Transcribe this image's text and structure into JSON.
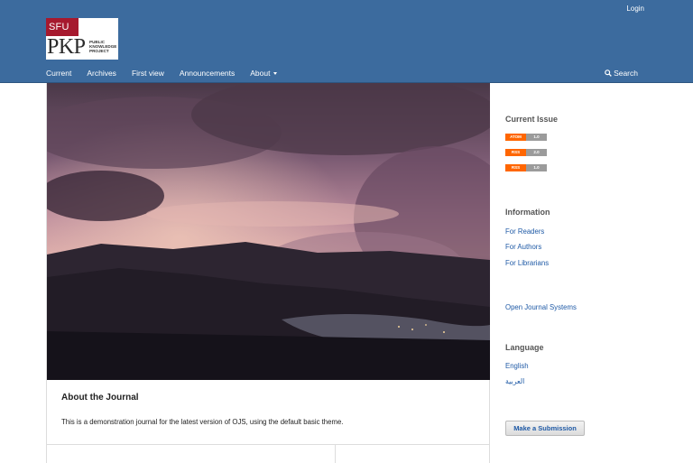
{
  "header": {
    "login_label": "Login",
    "logo": {
      "sfu": "SFU",
      "pkp": "PKP",
      "words": [
        "Public",
        "Knowledge",
        "Project"
      ]
    },
    "nav": [
      "Current",
      "Archives",
      "First view",
      "Announcements",
      "About"
    ],
    "search_label": "Search",
    "bg_color": "#3c6b9e"
  },
  "main": {
    "about_title": "About the Journal",
    "about_text": "This is a demonstration journal for the latest version of OJS, using the default basic theme."
  },
  "sidebar": {
    "current_issue_title": "Current Issue",
    "badges": [
      {
        "left": "ATOM",
        "right": "1.0"
      },
      {
        "left": "RSS",
        "right": "2.0"
      },
      {
        "left": "RSS",
        "right": "1.0"
      }
    ],
    "information_title": "Information",
    "info_links": [
      "For Readers",
      "For Authors",
      "For Librarians"
    ],
    "ojs_link": "Open Journal Systems",
    "language_title": "Language",
    "languages": [
      "English",
      "العربية"
    ],
    "submit_button": "Make a Submission",
    "link_color": "#1f5aa6"
  }
}
